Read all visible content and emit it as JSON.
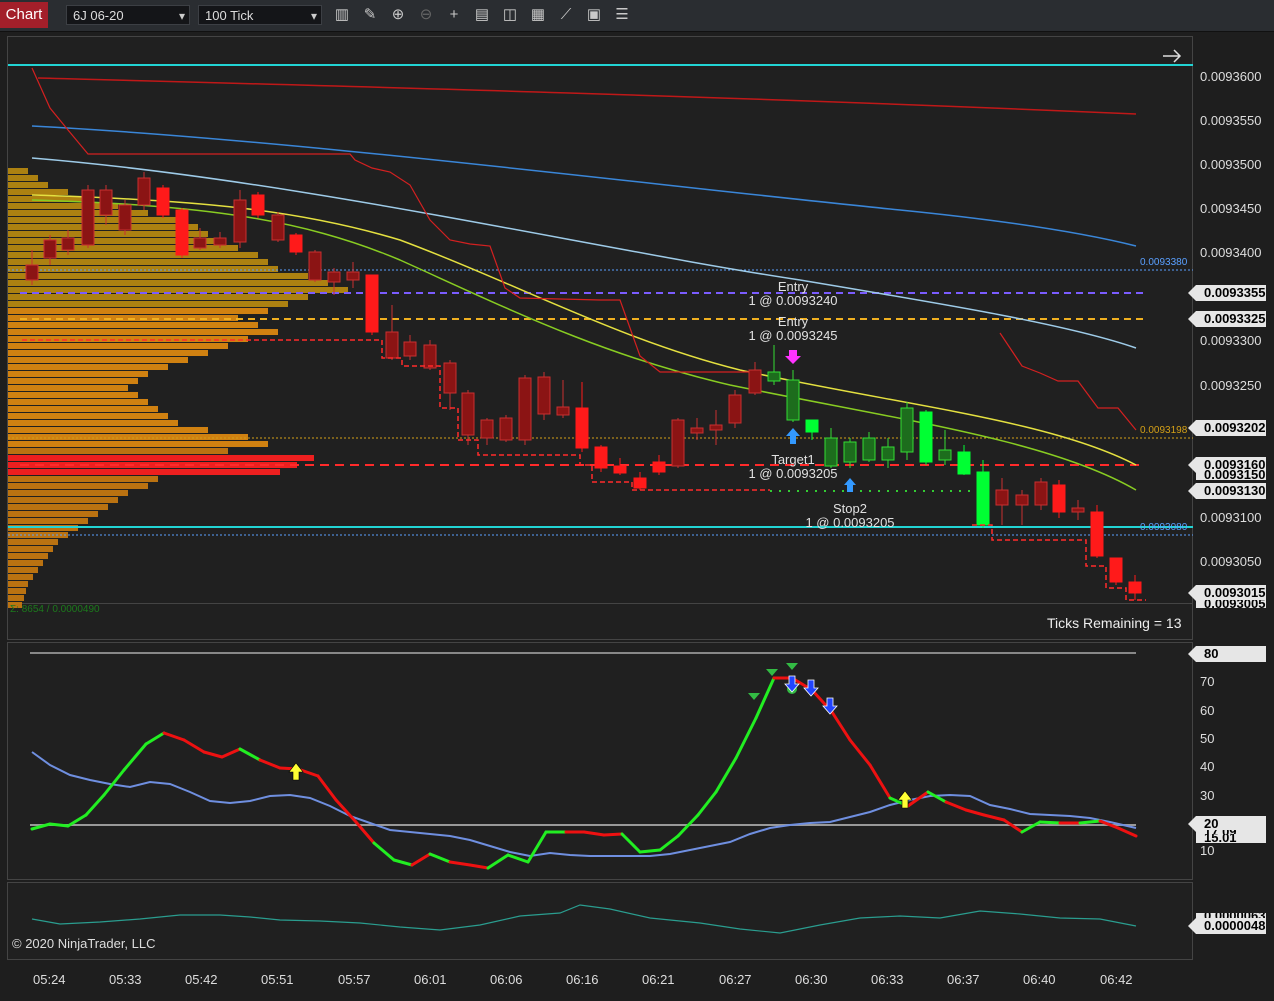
{
  "toolbar": {
    "chart_tab": "Chart",
    "instrument": "6J 06-20",
    "period": "100 Tick",
    "icons": [
      "bar-type-icon",
      "draw-tool-icon",
      "zoom-in-icon",
      "zoom-out-icon",
      "crosshair-icon",
      "data-box-icon",
      "strategies-icon",
      "indicators-icon",
      "drawing-objects-icon",
      "templates-icon",
      "properties-icon"
    ]
  },
  "price_axis": {
    "ticks": [
      "0.0093600",
      "0.0093550",
      "0.0093500",
      "0.0093450",
      "0.0093400",
      "0.0093350",
      "0.0093300",
      "0.0093250",
      "0.0093200",
      "0.0093150",
      "0.0093100",
      "0.0093050",
      "0.0093000"
    ],
    "labels": [
      "0.0093380",
      "0.0093355",
      "0.0093325",
      "0.0093202",
      "0.0093198",
      "0.0093160",
      "0.0093130",
      "0.0093080",
      "0.0093015",
      "0.0093005",
      "0.0093150"
    ],
    "label_colors": {
      "blue": "#5aa0ff",
      "gold": "#d4a017"
    }
  },
  "annotations": {
    "entry1_title": "Entry",
    "entry1_detail": "1 @ 0.0093240",
    "entry2_title": "Entry",
    "entry2_detail": "1 @ 0.0093245",
    "target1_title": "Target1",
    "target1_detail": "1 @ 0.0093205",
    "stop2_title": "Stop2",
    "stop2_detail": "1 @ 0.0093205",
    "volume_summary": "Σ: 8654 / 0.0000490",
    "ticks_remaining": "Ticks Remaining = 13"
  },
  "oscillator_axis": {
    "ticks": [
      "70",
      "60",
      "50",
      "40",
      "30",
      "20",
      "10"
    ],
    "labels": [
      "80",
      "20",
      "15.01",
      "17.09"
    ]
  },
  "bottom_axis": {
    "label": "0.0000048",
    "label2": "0.0000063"
  },
  "copyright": "© 2020 NinjaTrader, LLC",
  "time_axis": [
    "05:24",
    "05:33",
    "05:42",
    "05:51",
    "05:57",
    "06:01",
    "06:06",
    "06:16",
    "06:21",
    "06:27",
    "06:30",
    "06:33",
    "06:37",
    "06:40",
    "06:42"
  ],
  "colors": {
    "bull": "#00ff33",
    "bear": "#ff1a1a",
    "cyan": "#22d4d4",
    "ema_blue": "#3a86d8",
    "ema_light": "#9ecbe8",
    "ema_yellow": "#e4e040",
    "ema_green": "#88cc22",
    "stop_dots": "#e02020",
    "osc_line": "#6f8fe0"
  }
}
